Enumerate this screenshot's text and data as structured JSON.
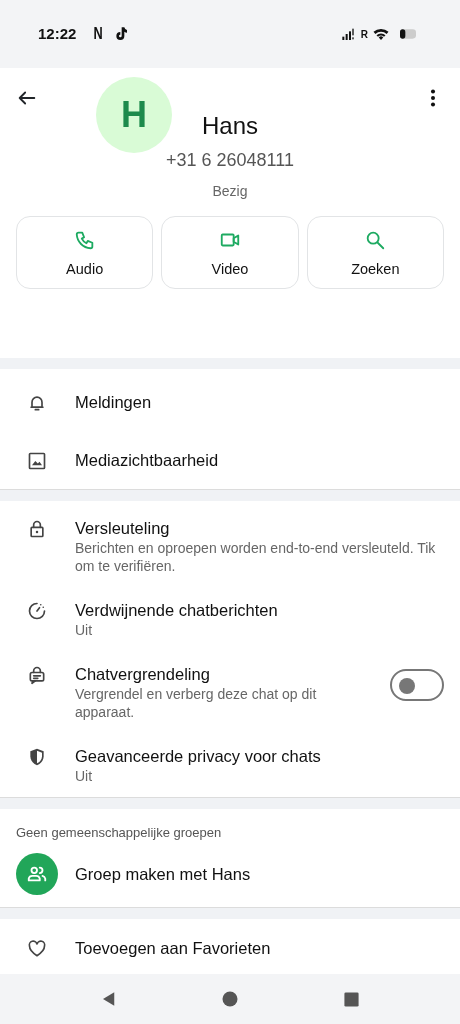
{
  "status_bar": {
    "time": "12:22",
    "app_badge": "N",
    "network_label": "R"
  },
  "contact": {
    "avatar_letter": "H",
    "name": "Hans",
    "phone": "+31 6 26048111",
    "status": "Bezig"
  },
  "actions": [
    {
      "label": "Audio",
      "kind": "audio"
    },
    {
      "label": "Video",
      "kind": "video"
    },
    {
      "label": "Zoeken",
      "kind": "search"
    }
  ],
  "sections": [
    {
      "items": [
        {
          "kind": "bell",
          "title": "Meldingen"
        },
        {
          "kind": "image",
          "title": "Mediazichtbaarheid"
        }
      ]
    },
    {
      "items": [
        {
          "kind": "lock",
          "title": "Versleuteling",
          "subtitle": "Berichten en oproepen worden end-to-end versleuteld. Tik om te verifiëren."
        },
        {
          "kind": "timer",
          "title": "Verdwijnende chatberichten",
          "subtitle": "Uit"
        },
        {
          "kind": "chatlock",
          "title": "Chatvergrendeling",
          "subtitle": "Vergrendel en verberg deze chat op dit apparaat.",
          "switch": {
            "checked": false
          }
        },
        {
          "kind": "shield",
          "title": "Geavanceerde privacy voor chats",
          "subtitle": "Uit"
        }
      ]
    }
  ],
  "groups": {
    "heading": "Geen gemeenschappelijke groepen",
    "items": [
      {
        "label": "Groep maken met Hans"
      }
    ]
  },
  "more": {
    "items": [
      {
        "kind": "heart",
        "title": "Toevoegen aan Favorieten"
      }
    ]
  }
}
